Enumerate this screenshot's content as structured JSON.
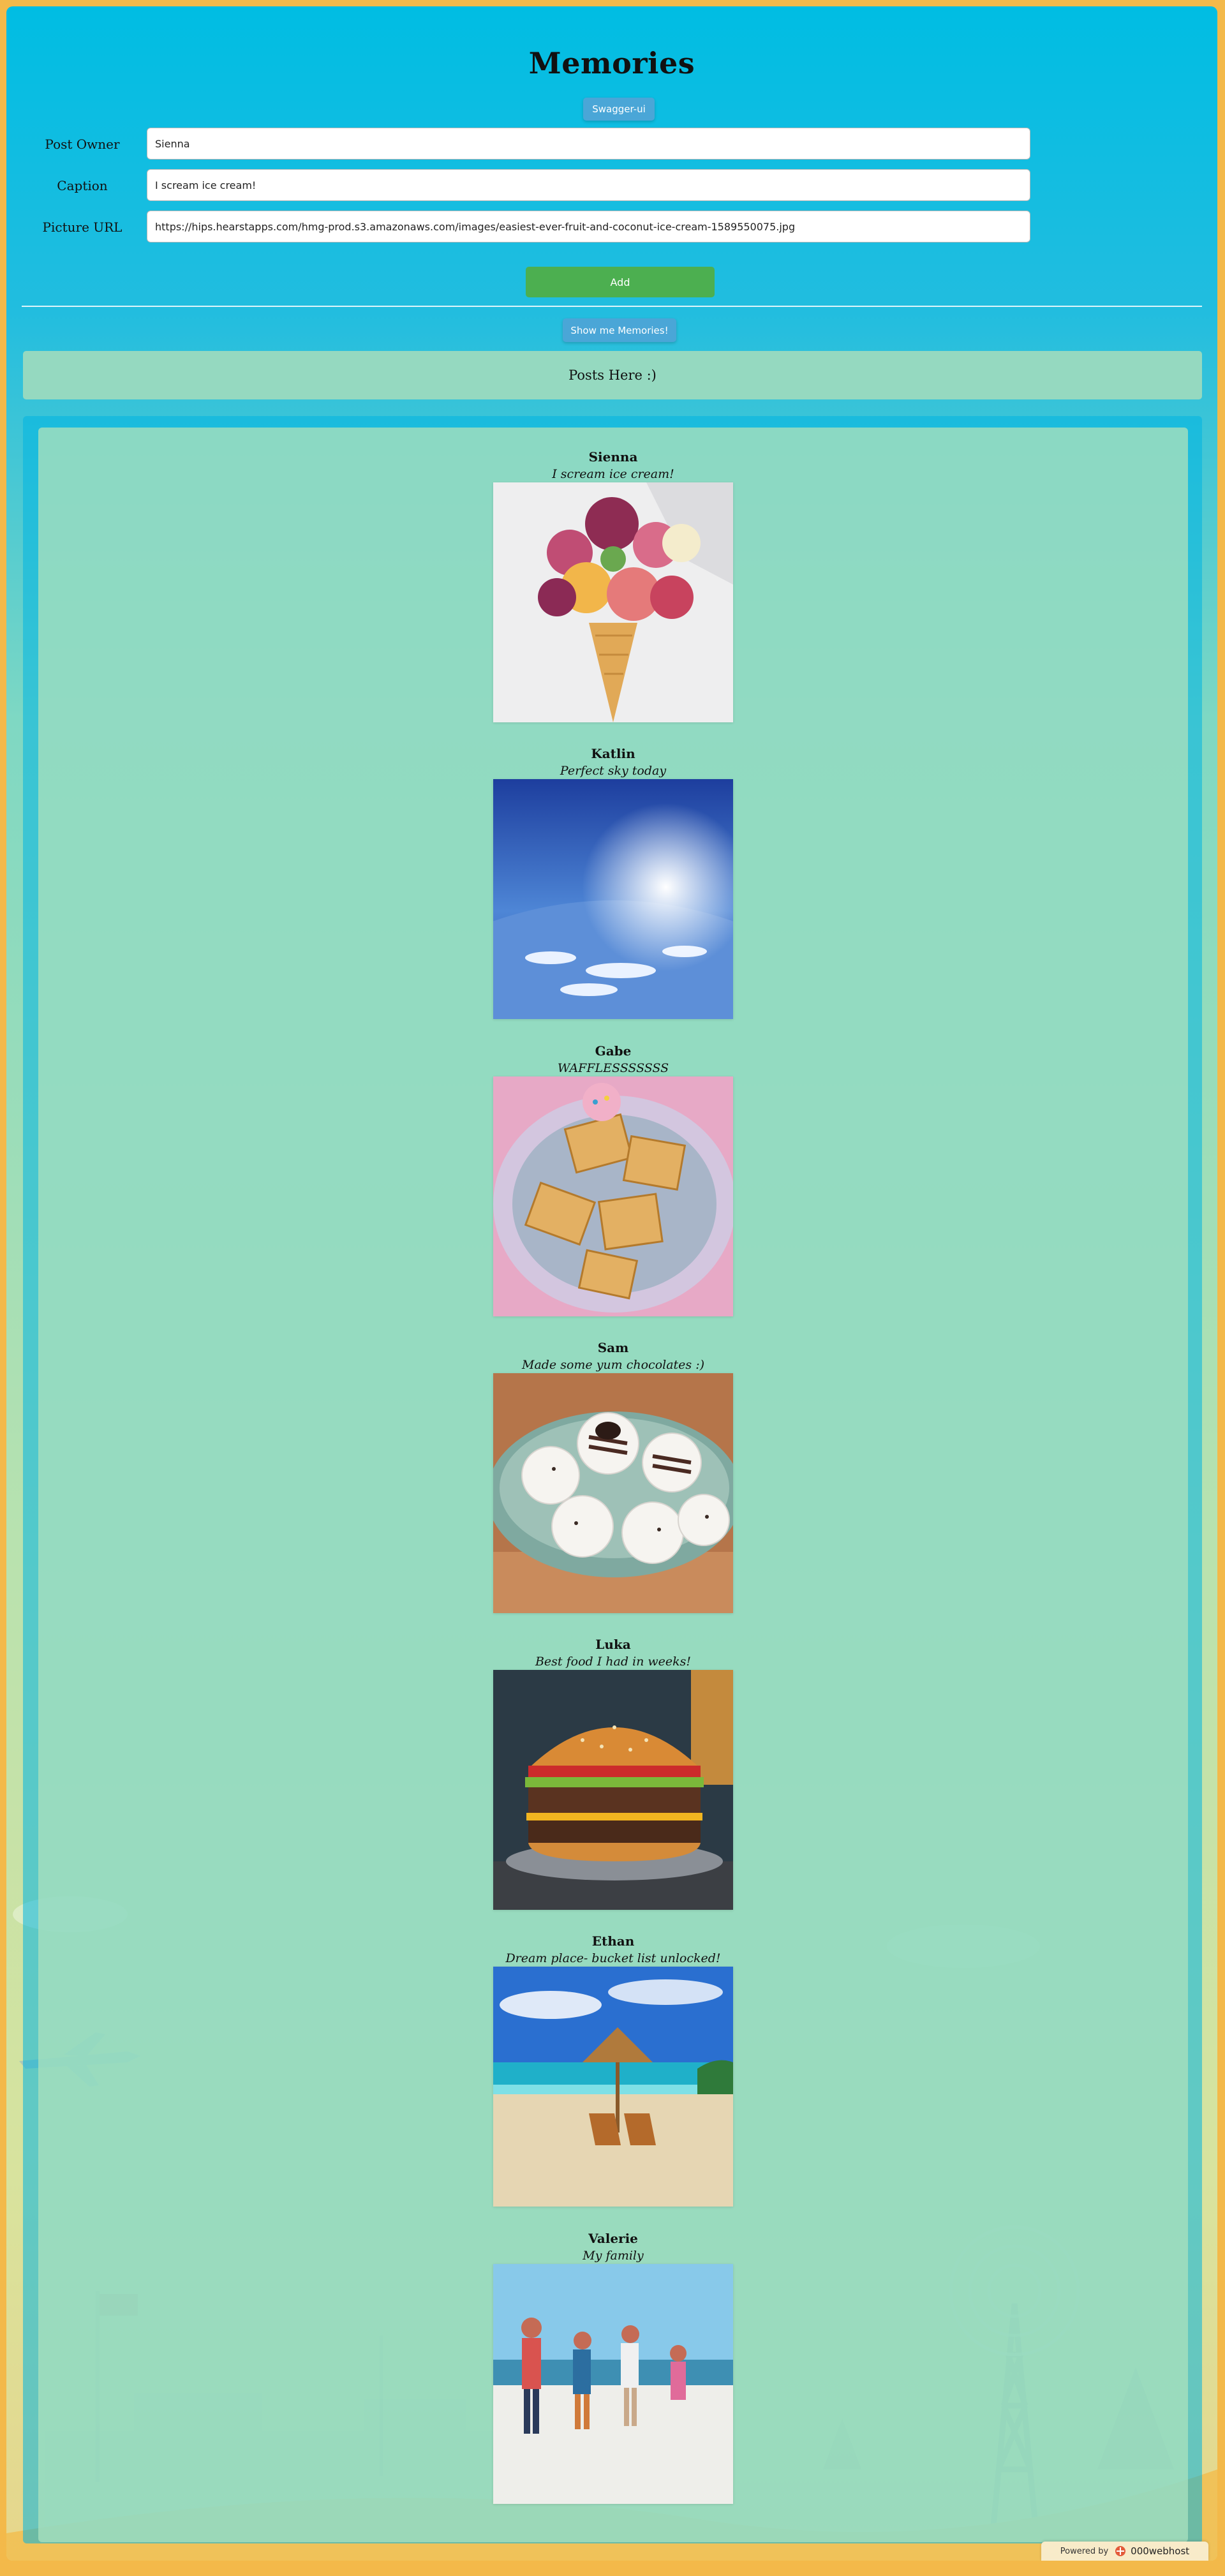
{
  "app": {
    "title": "Memories",
    "swagger_label": "Swagger-ui"
  },
  "form": {
    "owner_label": "Post Owner",
    "owner_value": "Sienna",
    "caption_label": "Caption",
    "caption_value": "I scream ice cream!",
    "url_label": "Picture URL",
    "url_value": "https://hips.hearstapps.com/hmg-prod.s3.amazonaws.com/images/easiest-ever-fruit-and-coconut-ice-cream-1589550075.jpg",
    "add_label": "Add"
  },
  "actions": {
    "show_label": "Show me Memories!"
  },
  "posts_banner": "Posts Here :)",
  "posts": [
    {
      "owner": "Sienna",
      "caption": "I scream ice cream!",
      "image": "ice-cream-cone"
    },
    {
      "owner": "Katlin",
      "caption": "Perfect sky today",
      "image": "sky-earth"
    },
    {
      "owner": "Gabe",
      "caption": "WAFFLESSSSSSS",
      "image": "waffles"
    },
    {
      "owner": "Sam",
      "caption": "Made some yum chocolates :)",
      "image": "chocolates"
    },
    {
      "owner": "Luka",
      "caption": "Best food I had in weeks!",
      "image": "burger"
    },
    {
      "owner": "Ethan",
      "caption": "Dream place- bucket list unlocked!",
      "image": "beach"
    },
    {
      "owner": "Valerie",
      "caption": "My family",
      "image": "family-beach"
    }
  ],
  "footer": {
    "powered_by": "Powered by",
    "host_name": "000webhost"
  },
  "colors": {
    "sky_top": "#00bde3",
    "banner": "#95d9c0",
    "button_blue": "#4aa6d7",
    "button_green": "#4caf50",
    "sand": "#f3b94a"
  }
}
